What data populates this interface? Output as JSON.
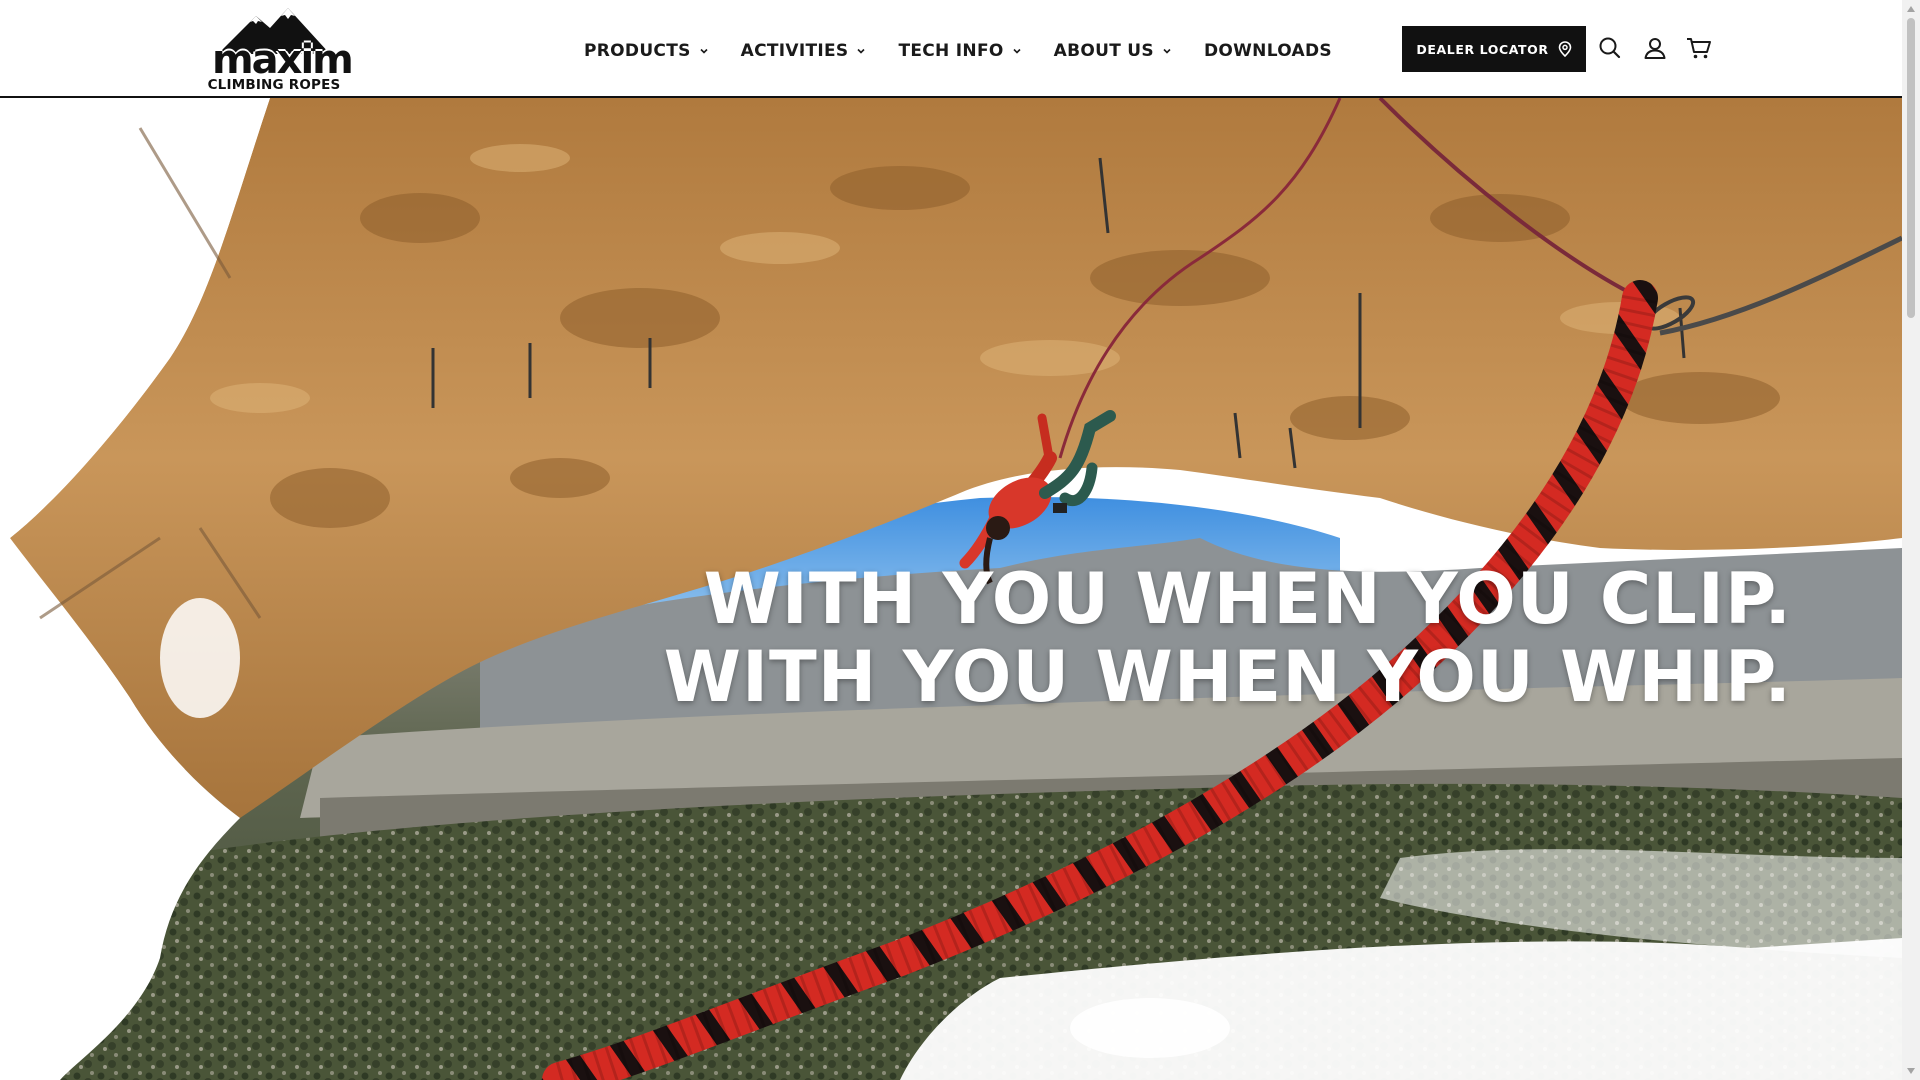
{
  "brand": {
    "logo_word": "maxim",
    "logo_subtitle": "CLIMBING ROPES"
  },
  "nav": {
    "items": [
      {
        "label": "PRODUCTS",
        "has_dropdown": true
      },
      {
        "label": "ACTIVITIES",
        "has_dropdown": true
      },
      {
        "label": "TECH INFO",
        "has_dropdown": true
      },
      {
        "label": "ABOUT US",
        "has_dropdown": true
      },
      {
        "label": "DOWNLOADS",
        "has_dropdown": false
      }
    ]
  },
  "header": {
    "dealer_locator_label": "DEALER LOCATOR",
    "icons": [
      "map-pin-icon",
      "search-icon",
      "account-icon",
      "cart-icon"
    ]
  },
  "hero": {
    "headline_line1": "WITH YOU WHEN YOU CLIP.",
    "headline_line2": "WITH YOU WHEN YOU WHIP."
  },
  "colors": {
    "header_bg": "#ffffff",
    "button_bg": "#111111",
    "rock": "#c8965a",
    "sky": "#6fb0e8",
    "rope_red": "#d42a22"
  }
}
